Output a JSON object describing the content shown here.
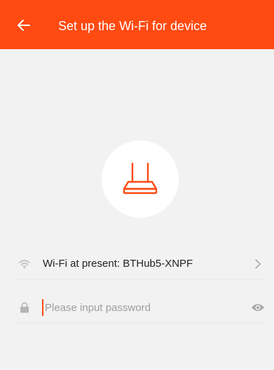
{
  "header": {
    "title": "Set up the Wi-Fi for device",
    "back_icon": "arrow-left-icon",
    "background_color": "#ff4a12"
  },
  "device": {
    "icon": "router-icon",
    "accent_color": "#ff4a12"
  },
  "wifi": {
    "label": "Wi-Fi at present: BTHub5-XNPF",
    "icon": "wifi-icon",
    "chevron_icon": "chevron-right-icon"
  },
  "password": {
    "value": "",
    "placeholder": "Please input password",
    "lock_icon": "lock-icon",
    "toggle_icon": "eye-icon"
  }
}
